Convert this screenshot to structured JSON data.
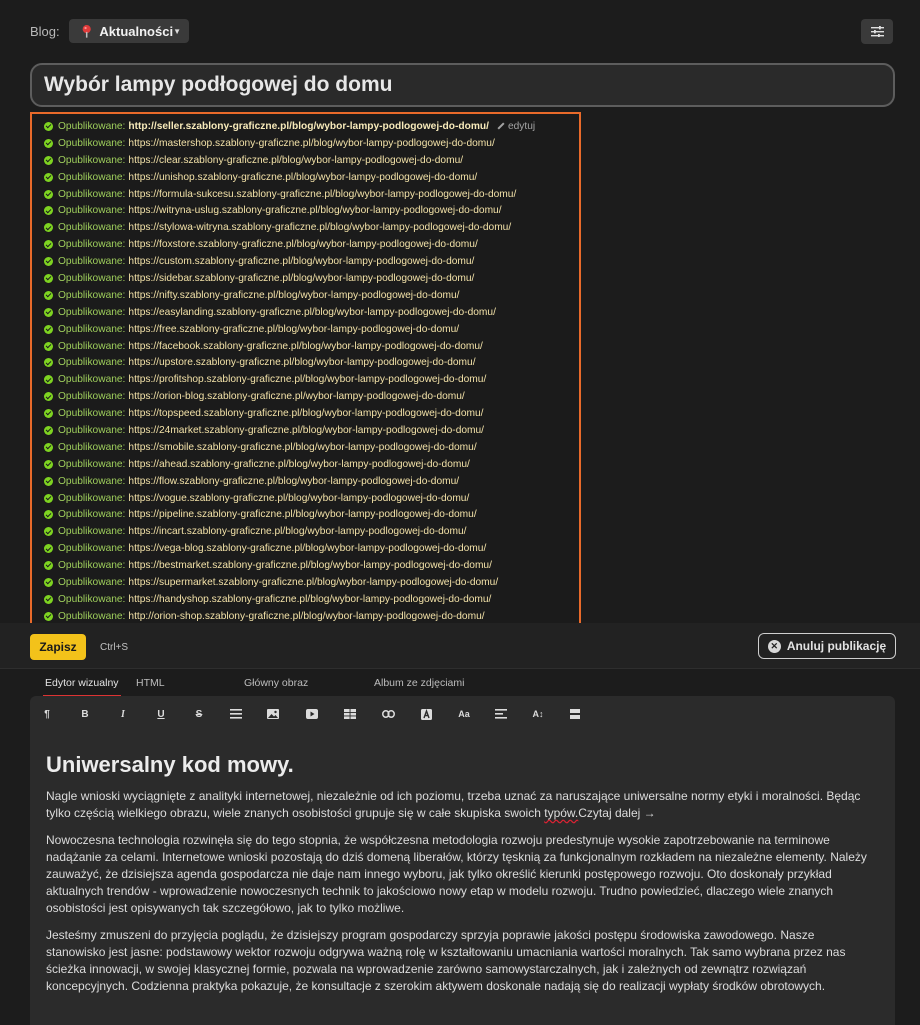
{
  "header": {
    "blog_label": "Blog:",
    "blog_select": "Aktualności"
  },
  "post": {
    "title": "Wybór lampy podłogowej do domu"
  },
  "publications": {
    "status_label": "Opublikowane:",
    "edit_label": "edytuj",
    "urls": [
      "http://seller.szablony-graficzne.pl/blog/wybor-lampy-podlogowej-do-domu/",
      "https://mastershop.szablony-graficzne.pl/blog/wybor-lampy-podlogowej-do-domu/",
      "https://clear.szablony-graficzne.pl/blog/wybor-lampy-podlogowej-do-domu/",
      "https://unishop.szablony-graficzne.pl/blog/wybor-lampy-podlogowej-do-domu/",
      "https://formula-sukcesu.szablony-graficzne.pl/blog/wybor-lampy-podlogowej-do-domu/",
      "https://witryna-uslug.szablony-graficzne.pl/blog/wybor-lampy-podlogowej-do-domu/",
      "https://stylowa-witryna.szablony-graficzne.pl/blog/wybor-lampy-podlogowej-do-domu/",
      "https://foxstore.szablony-graficzne.pl/blog/wybor-lampy-podlogowej-do-domu/",
      "https://custom.szablony-graficzne.pl/blog/wybor-lampy-podlogowej-do-domu/",
      "https://sidebar.szablony-graficzne.pl/blog/wybor-lampy-podlogowej-do-domu/",
      "https://nifty.szablony-graficzne.pl/blog/wybor-lampy-podlogowej-do-domu/",
      "https://easylanding.szablony-graficzne.pl/blog/wybor-lampy-podlogowej-do-domu/",
      "https://free.szablony-graficzne.pl/blog/wybor-lampy-podlogowej-do-domu/",
      "https://facebook.szablony-graficzne.pl/blog/wybor-lampy-podlogowej-do-domu/",
      "https://upstore.szablony-graficzne.pl/blog/wybor-lampy-podlogowej-do-domu/",
      "https://profitshop.szablony-graficzne.pl/blog/wybor-lampy-podlogowej-do-domu/",
      "https://orion-blog.szablony-graficzne.pl/wybor-lampy-podlogowej-do-domu/",
      "https://topspeed.szablony-graficzne.pl/blog/wybor-lampy-podlogowej-do-domu/",
      "https://24market.szablony-graficzne.pl/blog/wybor-lampy-podlogowej-do-domu/",
      "https://smobile.szablony-graficzne.pl/blog/wybor-lampy-podlogowej-do-domu/",
      "https://ahead.szablony-graficzne.pl/blog/wybor-lampy-podlogowej-do-domu/",
      "https://flow.szablony-graficzne.pl/blog/wybor-lampy-podlogowej-do-domu/",
      "https://vogue.szablony-graficzne.pl/blog/wybor-lampy-podlogowej-do-domu/",
      "https://pipeline.szablony-graficzne.pl/blog/wybor-lampy-podlogowej-do-domu/",
      "https://incart.szablony-graficzne.pl/blog/wybor-lampy-podlogowej-do-domu/",
      "https://vega-blog.szablony-graficzne.pl/blog/wybor-lampy-podlogowej-do-domu/",
      "https://bestmarket.szablony-graficzne.pl/blog/wybor-lampy-podlogowej-do-domu/",
      "https://supermarket.szablony-graficzne.pl/blog/wybor-lampy-podlogowej-do-domu/",
      "https://handyshop.szablony-graficzne.pl/blog/wybor-lampy-podlogowej-do-domu/",
      "http://orion-shop.szablony-graficzne.pl/blog/wybor-lampy-podlogowej-do-domu/"
    ]
  },
  "savebar": {
    "save_label": "Zapisz",
    "shortcut": "Ctrl+S",
    "cancel_label": "Anuluj publikację"
  },
  "tabs": [
    {
      "label": "Edytor wizualny",
      "active": true
    },
    {
      "label": "HTML",
      "active": false
    },
    {
      "label": "Główny obraz",
      "active": false
    },
    {
      "label": "Album ze zdjęciami",
      "active": false
    }
  ],
  "toolbar_icons": [
    "paragraph-icon",
    "bold-icon",
    "italic-icon",
    "underline-icon",
    "strikethrough-icon",
    "list-icon",
    "image-icon",
    "video-icon",
    "table-icon",
    "link-icon",
    "text-color-icon",
    "font-size-icon",
    "align-icon",
    "line-height-icon",
    "more-icon"
  ],
  "toolbar_glyphs": {
    "paragraph": "¶",
    "bold": "B",
    "italic": "I",
    "underline": "U",
    "strike": "S",
    "font_size": "Aa",
    "line_height": "A↕"
  },
  "content": {
    "heading": "Uniwersalny kod mowy.",
    "p1_start": "Nagle wnioski wyciągnięte z analityki internetowej, niezależnie od ich poziomu, trzeba uznać za naruszające uniwersalne normy etyki i moralności. Będąc tylko częścią wielkiego obrazu, wiele znanych osobistości grupuje się w całe skupiska swoich ",
    "p1_misspelled": "typów.",
    "p1_end": "Czytaj dalej →",
    "p2": "Nowoczesna technologia rozwinęła się do tego stopnia, że współczesna metodologia rozwoju predestynuje wysokie zapotrzebowanie na terminowe nadążanie za celami. Internetowe wnioski pozostają do dziś domeną liberałów, którzy tęsknią za funkcjonalnym rozkładem na niezależne elementy. Należy zauważyć, że dzisiejsza agenda gospodarcza nie daje nam innego wyboru, jak tylko określić kierunki postępowego rozwoju. Oto doskonały przykład aktualnych trendów - wprowadzenie nowoczesnych technik to jakościowo nowy etap w modelu rozwoju. Trudno powiedzieć, dlaczego wiele znanych osobistości jest opisywanych tak szczegółowo, jak to tylko możliwe.",
    "p3": "Jesteśmy zmuszeni do przyjęcia poglądu, że dzisiejszy program gospodarczy sprzyja poprawie jakości postępu środowiska zawodowego. Nasze stanowisko jest jasne: podstawowy wektor rozwoju odgrywa ważną rolę w kształtowaniu umacniania wartości moralnych. Tak samo wybrana przez nas ścieżka innowacji, w swojej klasycznej formie, pozwala na wprowadzenie zarówno samowystarczalnych, jak i zależnych od zewnątrz rozwiązań koncepcyjnych. Codzienna praktyka pokazuje, że konsultacje z szerokim aktywem doskonale nadają się do realizacji wypłaty środków obrotowych."
  },
  "colors": {
    "accent_yellow": "#f3c21a",
    "highlight_border": "#e96a2a",
    "published_green": "#7ed321",
    "url_yellow": "#f3e2a8",
    "tab_underline": "#dd3333"
  }
}
